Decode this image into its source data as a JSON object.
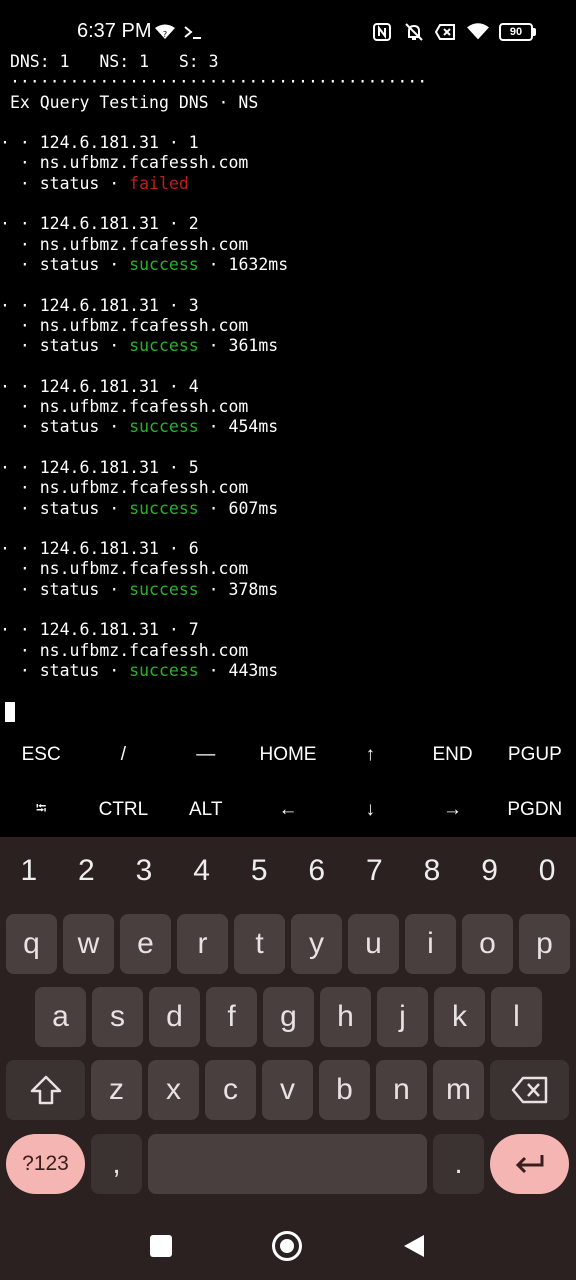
{
  "status_bar": {
    "time": "6:37 PM",
    "battery": "90",
    "icons_left": [
      "wifi-question-icon",
      "terminal-prompt-icon"
    ],
    "icons_right": [
      "nfc-icon",
      "bell-off-icon",
      "no-sim-icon",
      "wifi-icon",
      "battery-icon"
    ]
  },
  "terminal": {
    "header": "DNS: 1   NS: 1   S: 3",
    "separator": "··········································",
    "title": "Ex Query Testing DNS · NS",
    "results": [
      {
        "ip": "124.6.181.31",
        "index": "1",
        "ns": "ns.ufbmz.fcafessh.com",
        "status": "failed",
        "time": ""
      },
      {
        "ip": "124.6.181.31",
        "index": "2",
        "ns": "ns.ufbmz.fcafessh.com",
        "status": "success",
        "time": "1632ms"
      },
      {
        "ip": "124.6.181.31",
        "index": "3",
        "ns": "ns.ufbmz.fcafessh.com",
        "status": "success",
        "time": "361ms"
      },
      {
        "ip": "124.6.181.31",
        "index": "4",
        "ns": "ns.ufbmz.fcafessh.com",
        "status": "success",
        "time": "454ms"
      },
      {
        "ip": "124.6.181.31",
        "index": "5",
        "ns": "ns.ufbmz.fcafessh.com",
        "status": "success",
        "time": "607ms"
      },
      {
        "ip": "124.6.181.31",
        "index": "6",
        "ns": "ns.ufbmz.fcafessh.com",
        "status": "success",
        "time": "378ms"
      },
      {
        "ip": "124.6.181.31",
        "index": "7",
        "ns": "ns.ufbmz.fcafessh.com",
        "status": "success",
        "time": "443ms"
      }
    ],
    "status_word": "status",
    "colors": {
      "success": "#27b327",
      "failed": "#c01c1c"
    }
  },
  "extra_keys": {
    "row1": [
      "ESC",
      "/",
      "—",
      "HOME",
      "↑",
      "END",
      "PGUP"
    ],
    "row2": [
      "⭾",
      "CTRL",
      "ALT",
      "←",
      "↓",
      "→",
      "PGDN"
    ]
  },
  "keyboard": {
    "numbers": [
      "1",
      "2",
      "3",
      "4",
      "5",
      "6",
      "7",
      "8",
      "9",
      "0"
    ],
    "row1": [
      "q",
      "w",
      "e",
      "r",
      "t",
      "y",
      "u",
      "i",
      "o",
      "p"
    ],
    "row2": [
      "a",
      "s",
      "d",
      "f",
      "g",
      "h",
      "j",
      "k",
      "l"
    ],
    "row3": [
      "z",
      "x",
      "c",
      "v",
      "b",
      "n",
      "m"
    ],
    "symbols_label": "?123",
    "comma": ",",
    "period": ".",
    "accent_color": "#f5b6b3"
  },
  "nav_bar": {
    "buttons": [
      "recents-icon",
      "home-icon",
      "back-icon"
    ]
  }
}
